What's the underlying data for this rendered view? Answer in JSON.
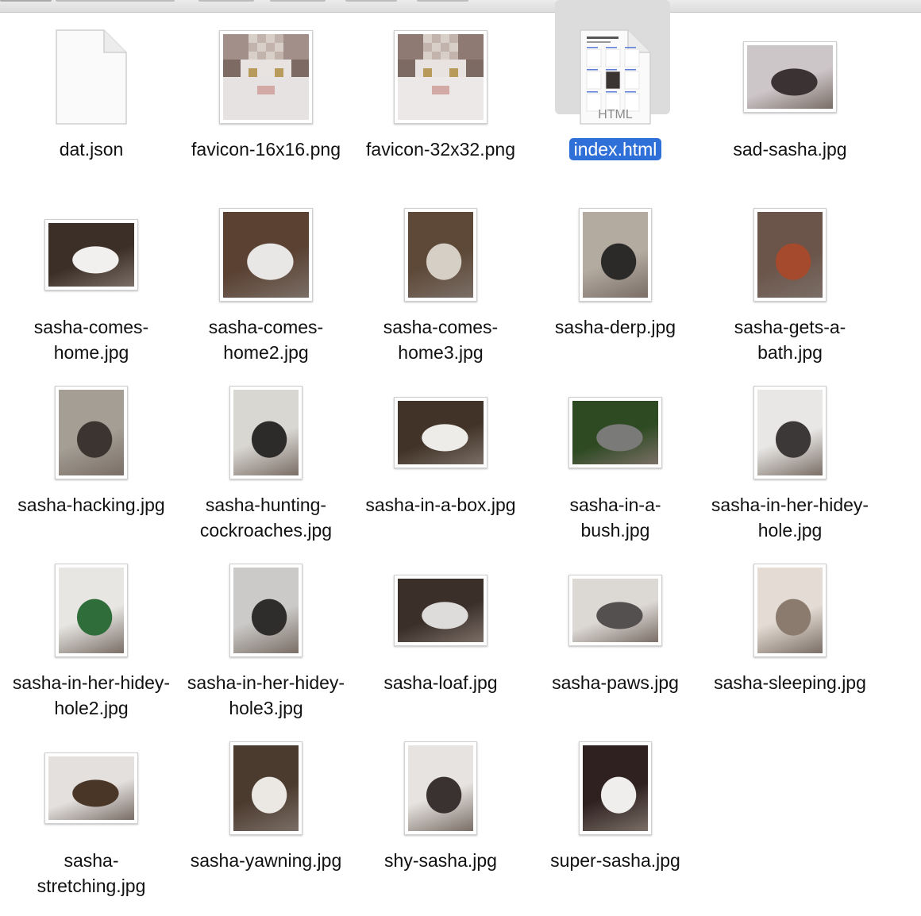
{
  "files": [
    {
      "name": "dat.json",
      "kind": "doc",
      "tone": [
        "#ffffff",
        "#ffffff"
      ]
    },
    {
      "name": "favicon-16x16.png",
      "kind": "pixel",
      "tone": [
        "#a38f8a",
        "#e6e2e2"
      ]
    },
    {
      "name": "favicon-32x32.png",
      "kind": "pixel",
      "tone": [
        "#8f7a73",
        "#ece8e8"
      ]
    },
    {
      "name": "index.html",
      "kind": "html",
      "selected": true,
      "doc_text": "HTML",
      "tone": [
        "#ffffff",
        "#ffffff"
      ]
    },
    {
      "name": "sad-sasha.jpg",
      "kind": "photo-wide",
      "tone": [
        "#cdc6c9",
        "#3a3233"
      ]
    },
    {
      "name": "sasha-comes-home.jpg",
      "kind": "photo-wide",
      "tone": [
        "#3c2f28",
        "#f2f0ee"
      ]
    },
    {
      "name": "sasha-comes-home2.jpg",
      "kind": "photo-sq",
      "tone": [
        "#5a4132",
        "#e9e7e6"
      ]
    },
    {
      "name": "sasha-comes-home3.jpg",
      "kind": "photo-tall",
      "tone": [
        "#5e4938",
        "#d6cfc6"
      ]
    },
    {
      "name": "sasha-derp.jpg",
      "kind": "photo-tall",
      "tone": [
        "#b3aaa0",
        "#2b2a29"
      ]
    },
    {
      "name": "sasha-gets-a-bath.jpg",
      "kind": "photo-tall",
      "tone": [
        "#6b544a",
        "#a54a2c"
      ]
    },
    {
      "name": "sasha-hacking.jpg",
      "kind": "photo-tall",
      "tone": [
        "#a49e95",
        "#3b3430"
      ]
    },
    {
      "name": "sasha-hunting-cockroaches.jpg",
      "kind": "photo-tall",
      "tone": [
        "#d9d7d2",
        "#2d2b2a"
      ]
    },
    {
      "name": "sasha-in-a-box.jpg",
      "kind": "photo-wide",
      "tone": [
        "#413327",
        "#eeece9"
      ]
    },
    {
      "name": "sasha-in-a-bush.jpg",
      "kind": "photo-wide",
      "tone": [
        "#2d4a22",
        "#7a7a78"
      ]
    },
    {
      "name": "sasha-in-her-hidey-hole.jpg",
      "kind": "photo-tall",
      "tone": [
        "#e8e7e5",
        "#3d3838"
      ]
    },
    {
      "name": "sasha-in-her-hidey-hole2.jpg",
      "kind": "photo-tall",
      "tone": [
        "#e7e6e3",
        "#2f6d3a"
      ]
    },
    {
      "name": "sasha-in-her-hidey-hole3.jpg",
      "kind": "photo-tall",
      "tone": [
        "#cbcac8",
        "#2f2d2c"
      ]
    },
    {
      "name": "sasha-loaf.jpg",
      "kind": "photo-wide",
      "tone": [
        "#3b2f2a",
        "#dedcdb"
      ]
    },
    {
      "name": "sasha-paws.jpg",
      "kind": "photo-wide",
      "tone": [
        "#dcd8d4",
        "#555050"
      ]
    },
    {
      "name": "sasha-sleeping.jpg",
      "kind": "photo-tall",
      "tone": [
        "#e4dcd4",
        "#8b7b6e"
      ]
    },
    {
      "name": "sasha-stretching.jpg",
      "kind": "photo-wide",
      "tone": [
        "#e3e0de",
        "#4a3626"
      ]
    },
    {
      "name": "sasha-yawning.jpg",
      "kind": "photo-tall",
      "tone": [
        "#4b3a2e",
        "#ebe7e3"
      ]
    },
    {
      "name": "shy-sasha.jpg",
      "kind": "photo-tall",
      "tone": [
        "#e6e3e0",
        "#3a3231"
      ]
    },
    {
      "name": "super-sasha.jpg",
      "kind": "photo-tall",
      "tone": [
        "#2e2120",
        "#f0eeec"
      ]
    }
  ]
}
